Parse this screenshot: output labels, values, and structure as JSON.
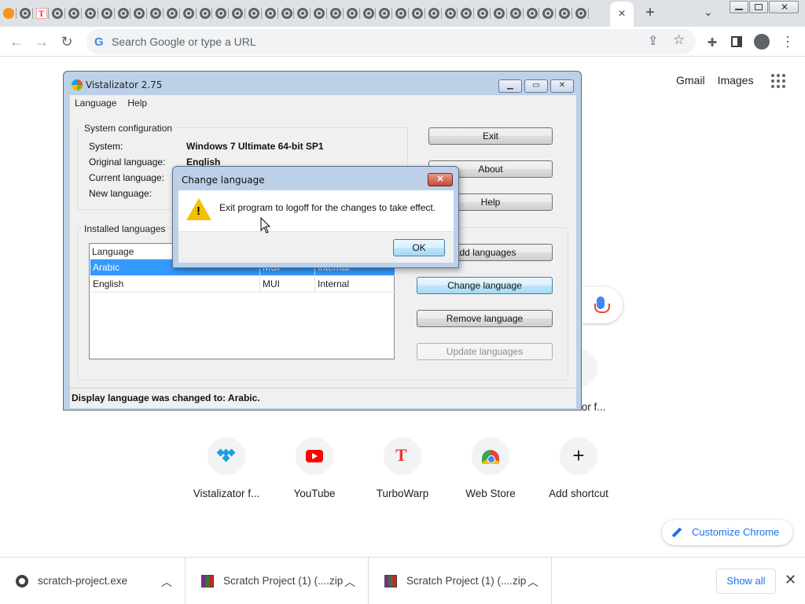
{
  "browser": {
    "omnibox_placeholder": "Search Google or type a URL",
    "active_tab_close": "×",
    "new_tab": "+",
    "tab_menu": "⌄"
  },
  "ntp": {
    "links": [
      "Gmail",
      "Images"
    ],
    "partial_shortcut_label": "tor f...",
    "shortcuts": [
      {
        "label": "Vistalizator f...",
        "icon": "vistalizator-icon"
      },
      {
        "label": "YouTube",
        "icon": "youtube-icon"
      },
      {
        "label": "TurboWarp",
        "icon": "turbowarp-icon"
      },
      {
        "label": "Web Store",
        "icon": "web-store-icon"
      },
      {
        "label": "Add shortcut",
        "icon": "plus-icon"
      }
    ],
    "customize_label": "Customize Chrome"
  },
  "downloads": {
    "items": [
      {
        "name": "scratch-project.exe",
        "icon": "exe"
      },
      {
        "name": "Scratch Project (1) (....zip",
        "icon": "zip"
      },
      {
        "name": "Scratch Project (1) (....zip",
        "icon": "zip"
      }
    ],
    "show_all": "Show all"
  },
  "vistalizator": {
    "title": "Vistalizator 2.75",
    "menu": [
      "Language",
      "Help"
    ],
    "system_config": {
      "heading": "System configuration",
      "system_label": "System:",
      "system_value": "Windows 7 Ultimate 64-bit SP1",
      "original_label": "Original language:",
      "original_value": "English",
      "current_label": "Current language:",
      "new_label": "New language:"
    },
    "installed": {
      "heading": "Installed languages",
      "columns": [
        "Language",
        "",
        ""
      ],
      "rows": [
        {
          "lang": "Arabic",
          "type": "MUI",
          "source": "Internal",
          "selected": true
        },
        {
          "lang": "English",
          "type": "MUI",
          "source": "Internal",
          "selected": false
        }
      ]
    },
    "buttons": {
      "exit": "Exit",
      "about": "About",
      "help": "Help",
      "add": "Add languages",
      "change": "Change language",
      "remove": "Remove language",
      "update": "Update languages"
    },
    "status": "Display language was changed to: Arabic."
  },
  "dialog": {
    "title": "Change language",
    "message": "Exit program to logoff for the changes to take effect.",
    "ok": "OK",
    "close": "✕"
  },
  "colors": {
    "selection": "#3399ff",
    "link_blue": "#1a73e8",
    "youtube_red": "#ff0000"
  }
}
